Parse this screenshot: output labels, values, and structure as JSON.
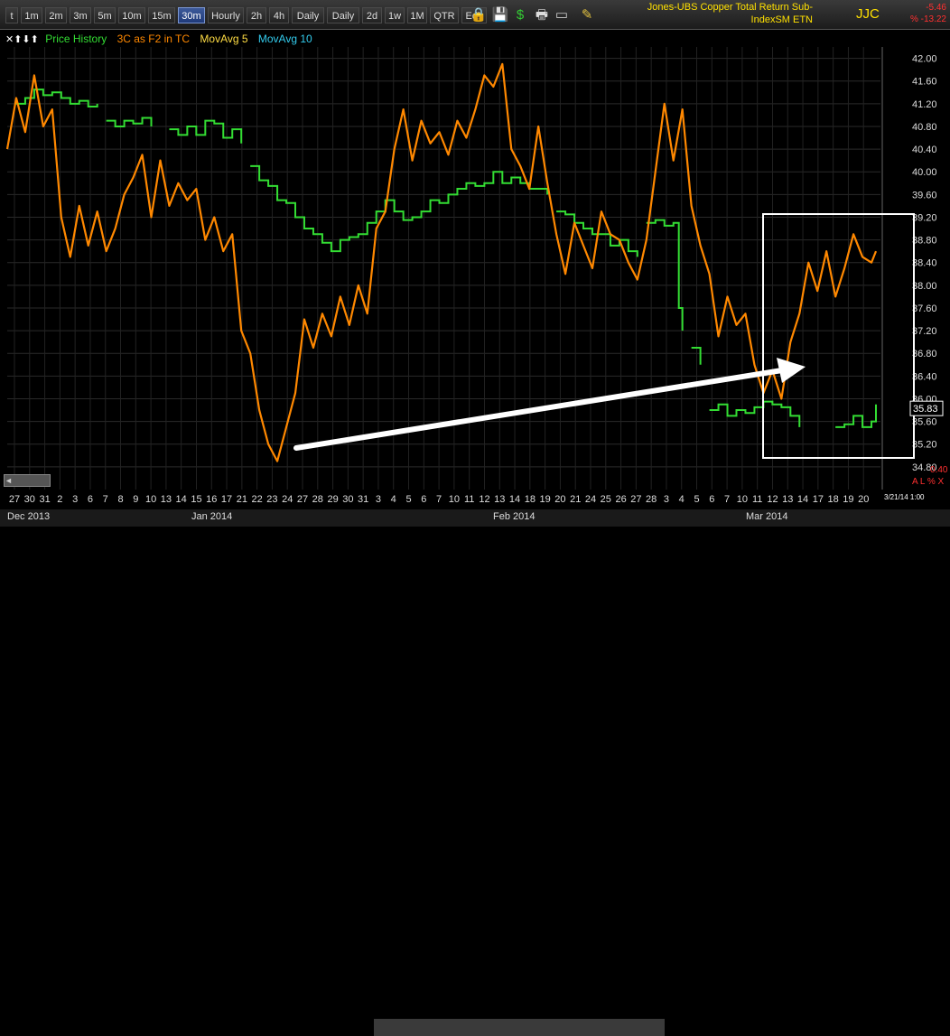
{
  "toolbar": {
    "timeframes": [
      "t",
      "1m",
      "2m",
      "3m",
      "5m",
      "10m",
      "15m",
      "30m",
      "Hourly",
      "2h",
      "4h",
      "Daily",
      "Daily",
      "2d",
      "1w",
      "1M",
      "QTR",
      "Edit"
    ],
    "active": "30m",
    "icons": [
      "padlock-icon",
      "save-disk-icon",
      "dollar-icon",
      "print-icon",
      "window-icon",
      "pen-icon"
    ]
  },
  "symbol": {
    "title_line1": "Jones-UBS Copper Total Return Sub-",
    "title_line2": "IndexSM ETN",
    "ticker": "JJC",
    "change": "-5.46",
    "change_pct": "% -13.22"
  },
  "legend": {
    "controls": "✕⬆⬇⬆",
    "items": [
      {
        "label": "Price History",
        "color": "#33dd33"
      },
      {
        "label": "3C as F2 in TC",
        "color": "#ff8800"
      },
      {
        "label": "MovAvg 5",
        "color": "#ffdd44"
      },
      {
        "label": "MovAvg 10",
        "color": "#33ccee"
      }
    ]
  },
  "chart_data": {
    "type": "line",
    "ylim": [
      34.4,
      42.2
    ],
    "y_ticks": [
      "42.00",
      "41.60",
      "41.20",
      "40.80",
      "40.40",
      "40.00",
      "39.60",
      "39.20",
      "38.80",
      "38.40",
      "38.00",
      "37.60",
      "37.20",
      "36.80",
      "36.40",
      "36.00",
      "35.60",
      "35.20",
      "34.80"
    ],
    "last_price": "35.83",
    "x_ticks": [
      "27",
      "30",
      "31",
      "2",
      "3",
      "6",
      "7",
      "8",
      "9",
      "10",
      "13",
      "14",
      "15",
      "16",
      "17",
      "21",
      "22",
      "23",
      "24",
      "27",
      "28",
      "29",
      "30",
      "31",
      "3",
      "4",
      "5",
      "6",
      "7",
      "10",
      "11",
      "12",
      "13",
      "14",
      "18",
      "19",
      "20",
      "21",
      "24",
      "25",
      "26",
      "27",
      "28",
      "3",
      "4",
      "5",
      "6",
      "7",
      "10",
      "11",
      "12",
      "13",
      "14",
      "17",
      "18",
      "19",
      "20"
    ],
    "months": [
      "Dec 2013",
      "Jan 2014",
      "Feb 2014",
      "Mar 2014"
    ],
    "date_stamp": "3/21/14 1:00",
    "right_low": "0.40",
    "right_flags": "A L % X",
    "series": [
      {
        "name": "Price History",
        "color": "#33dd33",
        "points": [
          [
            0,
            40.9
          ],
          [
            1,
            41.2
          ],
          [
            2,
            41.3
          ],
          [
            3,
            41.45
          ],
          [
            4,
            41.35
          ],
          [
            5,
            41.4
          ],
          [
            6,
            41.3
          ],
          [
            7,
            41.2
          ],
          [
            8,
            41.25
          ],
          [
            9,
            41.15
          ],
          [
            10,
            41.2
          ],
          [
            11,
            40.9
          ],
          [
            12,
            40.8
          ],
          [
            13,
            40.9
          ],
          [
            14,
            40.85
          ],
          [
            15,
            40.95
          ],
          [
            16,
            40.8
          ],
          [
            17,
            40.2
          ],
          [
            18,
            40.75
          ],
          [
            19,
            40.65
          ],
          [
            20,
            40.8
          ],
          [
            21,
            40.65
          ],
          [
            22,
            40.9
          ],
          [
            23,
            40.85
          ],
          [
            24,
            40.6
          ],
          [
            25,
            40.75
          ],
          [
            26,
            40.5
          ],
          [
            27,
            40.1
          ],
          [
            28,
            39.85
          ],
          [
            29,
            39.75
          ],
          [
            30,
            39.5
          ],
          [
            31,
            39.45
          ],
          [
            32,
            39.2
          ],
          [
            33,
            39.0
          ],
          [
            34,
            38.9
          ],
          [
            35,
            38.75
          ],
          [
            36,
            38.6
          ],
          [
            37,
            38.8
          ],
          [
            38,
            38.85
          ],
          [
            39,
            38.9
          ],
          [
            40,
            39.1
          ],
          [
            41,
            39.3
          ],
          [
            42,
            39.5
          ],
          [
            43,
            39.3
          ],
          [
            44,
            39.15
          ],
          [
            45,
            39.2
          ],
          [
            46,
            39.3
          ],
          [
            47,
            39.5
          ],
          [
            48,
            39.45
          ],
          [
            49,
            39.6
          ],
          [
            50,
            39.7
          ],
          [
            51,
            39.8
          ],
          [
            52,
            39.75
          ],
          [
            53,
            39.8
          ],
          [
            54,
            40.0
          ],
          [
            55,
            39.8
          ],
          [
            56,
            39.9
          ],
          [
            57,
            39.8
          ],
          [
            58,
            39.7
          ],
          [
            59,
            39.7
          ],
          [
            60,
            39.6
          ],
          [
            61,
            39.3
          ],
          [
            62,
            39.25
          ],
          [
            63,
            39.1
          ],
          [
            64,
            39.0
          ],
          [
            65,
            38.9
          ],
          [
            66,
            38.9
          ],
          [
            67,
            38.7
          ],
          [
            68,
            38.8
          ],
          [
            69,
            38.6
          ],
          [
            70,
            38.5
          ],
          [
            71,
            39.1
          ],
          [
            72,
            39.15
          ],
          [
            73,
            39.05
          ],
          [
            74,
            39.1
          ],
          [
            74.6,
            37.6
          ],
          [
            75,
            37.2
          ],
          [
            76,
            36.9
          ],
          [
            77,
            36.6
          ],
          [
            78,
            35.8
          ],
          [
            79,
            35.9
          ],
          [
            80,
            35.7
          ],
          [
            81,
            35.8
          ],
          [
            82,
            35.75
          ],
          [
            83,
            35.85
          ],
          [
            84,
            35.95
          ],
          [
            85,
            35.9
          ],
          [
            86,
            35.85
          ],
          [
            87,
            35.7
          ],
          [
            88,
            35.5
          ],
          [
            89,
            34.9
          ],
          [
            90,
            35.8
          ],
          [
            91,
            36.3
          ],
          [
            92,
            35.5
          ],
          [
            93,
            35.55
          ],
          [
            94,
            35.7
          ],
          [
            95,
            35.5
          ],
          [
            96,
            35.6
          ],
          [
            96.5,
            35.9
          ]
        ]
      },
      {
        "name": "3C as F2 in TC",
        "color": "#ff8800",
        "points": [
          [
            0,
            40.4
          ],
          [
            1,
            41.3
          ],
          [
            2,
            40.7
          ],
          [
            3,
            41.7
          ],
          [
            4,
            40.8
          ],
          [
            5,
            41.1
          ],
          [
            6,
            39.2
          ],
          [
            7,
            38.5
          ],
          [
            8,
            39.4
          ],
          [
            9,
            38.7
          ],
          [
            10,
            39.3
          ],
          [
            11,
            38.6
          ],
          [
            12,
            39.0
          ],
          [
            13,
            39.6
          ],
          [
            14,
            39.9
          ],
          [
            15,
            40.3
          ],
          [
            16,
            39.2
          ],
          [
            17,
            40.2
          ],
          [
            18,
            39.4
          ],
          [
            19,
            39.8
          ],
          [
            20,
            39.5
          ],
          [
            21,
            39.7
          ],
          [
            22,
            38.8
          ],
          [
            23,
            39.2
          ],
          [
            24,
            38.6
          ],
          [
            25,
            38.9
          ],
          [
            26,
            37.2
          ],
          [
            27,
            36.8
          ],
          [
            28,
            35.8
          ],
          [
            29,
            35.2
          ],
          [
            30,
            34.9
          ],
          [
            31,
            35.5
          ],
          [
            32,
            36.1
          ],
          [
            33,
            37.4
          ],
          [
            34,
            36.9
          ],
          [
            35,
            37.5
          ],
          [
            36,
            37.1
          ],
          [
            37,
            37.8
          ],
          [
            38,
            37.3
          ],
          [
            39,
            38.0
          ],
          [
            40,
            37.5
          ],
          [
            41,
            39.0
          ],
          [
            42,
            39.3
          ],
          [
            43,
            40.4
          ],
          [
            44,
            41.1
          ],
          [
            45,
            40.2
          ],
          [
            46,
            40.9
          ],
          [
            47,
            40.5
          ],
          [
            48,
            40.7
          ],
          [
            49,
            40.3
          ],
          [
            50,
            40.9
          ],
          [
            51,
            40.6
          ],
          [
            52,
            41.1
          ],
          [
            53,
            41.7
          ],
          [
            54,
            41.5
          ],
          [
            55,
            41.9
          ],
          [
            56,
            40.4
          ],
          [
            57,
            40.1
          ],
          [
            58,
            39.7
          ],
          [
            59,
            40.8
          ],
          [
            60,
            39.8
          ],
          [
            61,
            38.9
          ],
          [
            62,
            38.2
          ],
          [
            63,
            39.1
          ],
          [
            64,
            38.7
          ],
          [
            65,
            38.3
          ],
          [
            66,
            39.3
          ],
          [
            67,
            38.9
          ],
          [
            68,
            38.8
          ],
          [
            69,
            38.4
          ],
          [
            70,
            38.1
          ],
          [
            71,
            38.8
          ],
          [
            72,
            40.0
          ],
          [
            73,
            41.2
          ],
          [
            74,
            40.2
          ],
          [
            75,
            41.1
          ],
          [
            76,
            39.4
          ],
          [
            77,
            38.7
          ],
          [
            78,
            38.2
          ],
          [
            79,
            37.1
          ],
          [
            80,
            37.8
          ],
          [
            81,
            37.3
          ],
          [
            82,
            37.5
          ],
          [
            83,
            36.6
          ],
          [
            84,
            36.1
          ],
          [
            85,
            36.5
          ],
          [
            86,
            36.0
          ],
          [
            87,
            37.0
          ],
          [
            88,
            37.5
          ],
          [
            89,
            38.4
          ],
          [
            90,
            37.9
          ],
          [
            91,
            38.6
          ],
          [
            92,
            37.8
          ],
          [
            93,
            38.3
          ],
          [
            94,
            38.9
          ],
          [
            95,
            38.5
          ],
          [
            96,
            38.4
          ],
          [
            96.5,
            38.6
          ]
        ]
      }
    ]
  }
}
